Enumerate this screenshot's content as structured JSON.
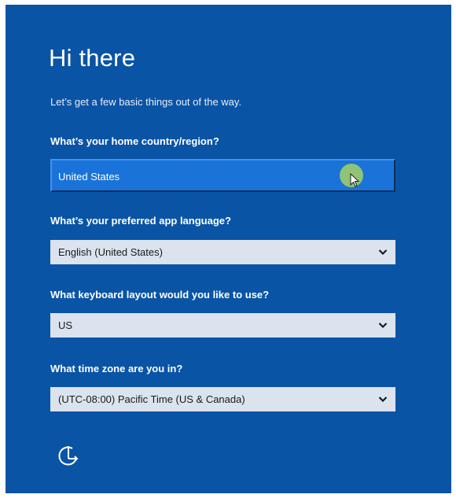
{
  "heading": "Hi there",
  "subtitle": "Let’s get a few basic things out of the way.",
  "country": {
    "label": "What’s your home country/region?",
    "value": "United States"
  },
  "language": {
    "label": "What’s your preferred app language?",
    "value": "English (United States)"
  },
  "keyboard": {
    "label": "What keyboard layout would you like to use?",
    "value": "US"
  },
  "timezone": {
    "label": "What time zone are you in?",
    "value": "(UTC-08:00) Pacific Time (US & Canada)"
  },
  "icons": {
    "dropdown": "chevron-down-icon",
    "accessibility": "ease-of-access-icon",
    "cursor": "mouse-cursor-icon"
  },
  "colors": {
    "background": "#0a54a6",
    "field": "#dbe3ee",
    "field_active": "#1a73d8",
    "cursor_highlight": "#9ccc6a"
  }
}
